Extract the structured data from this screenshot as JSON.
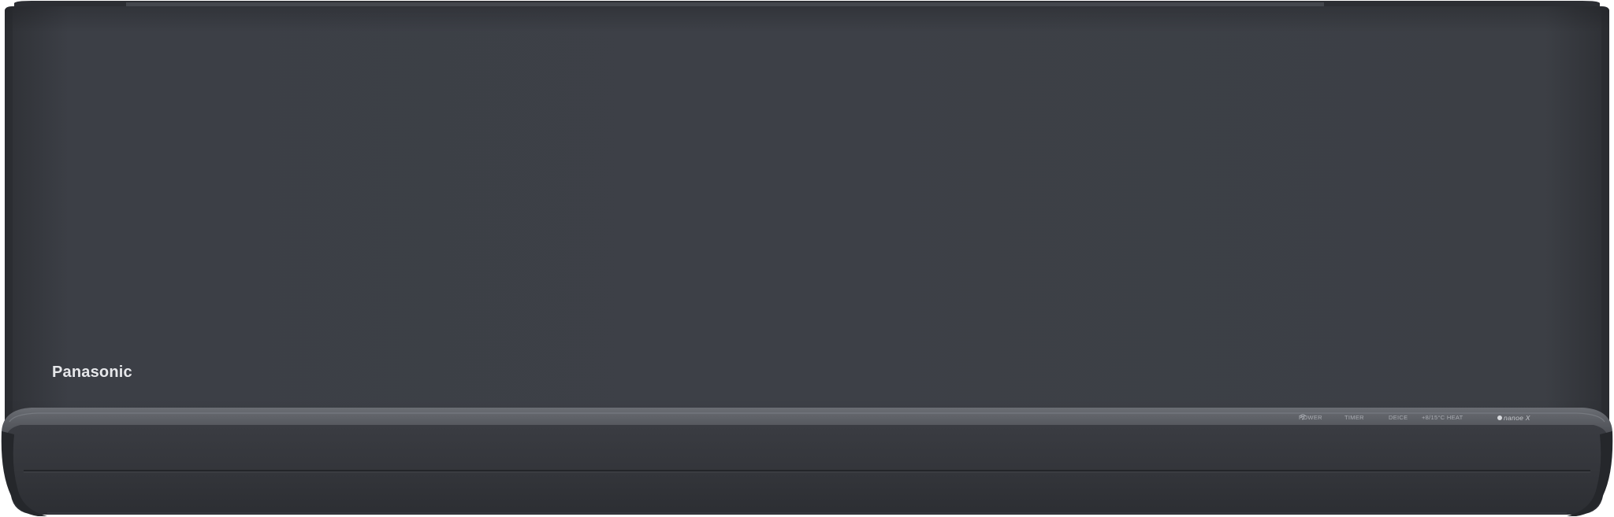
{
  "brand": {
    "logo_text": "Panasonic"
  },
  "indicators": {
    "power": "POWER",
    "timer": "TIMER",
    "deice": "DEICE",
    "heat": "+8/15°C HEAT",
    "wifi_icon": "wifi-icon",
    "nanoe": "nanoe X"
  },
  "colors": {
    "body": "#3b3e44",
    "body_edge": "#2e3035",
    "flap": "#34363b",
    "trim": "#5d6066",
    "logo": "#e6e7ea"
  }
}
